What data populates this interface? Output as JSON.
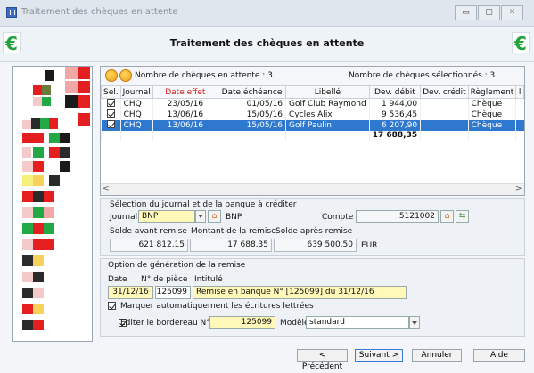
{
  "window": {
    "title": "Traitement des chèques en attente",
    "min": "▭",
    "max": "▢",
    "close": "✕"
  },
  "header": {
    "title": "Traitement des chèques en attente",
    "currency_symbol": "€"
  },
  "grid": {
    "count_pending": "Nombre de chèques en attente : 3",
    "count_selected": "Nombre de chèques sélectionnés : 3",
    "columns": [
      "Sel.",
      "Journal",
      "Date effet",
      "Date échéance",
      "Libellé",
      "Dev. débit",
      "Dev. crédit",
      "Règlement",
      "l"
    ],
    "rows": [
      {
        "journal": "CHQ",
        "date_effet": "23/05/16",
        "date_echeance": "01/05/16",
        "libelle": "Golf Club Raymond",
        "debit": "1 944,00",
        "credit": "",
        "reglement": "Chèque",
        "selected": true,
        "highlighted": false
      },
      {
        "journal": "CHQ",
        "date_effet": "13/06/16",
        "date_echeance": "15/05/16",
        "libelle": "Cycles Alix",
        "debit": "9 536,45",
        "credit": "",
        "reglement": "Chèque",
        "selected": true,
        "highlighted": false
      },
      {
        "journal": "CHQ",
        "date_effet": "13/06/16",
        "date_echeance": "15/05/16",
        "libelle": "Golf Paulin",
        "debit": "6 207,90",
        "credit": "",
        "reglement": "Chèque",
        "selected": true,
        "highlighted": true
      }
    ],
    "total_debit": "17 688,35",
    "scroll_left": "<",
    "scroll_right": ">"
  },
  "journal_section": {
    "heading": "Sélection du journal et de la banque à créditer",
    "journal_label": "Journal",
    "journal_value": "BNP",
    "bank_code": "BNP",
    "compte_label": "Compte",
    "compte_value": "5121002",
    "house_glyph": "⌂",
    "arrows_glyph": "⇆",
    "solde_avant_label": "Solde avant remise",
    "montant_label": "Montant de la remise",
    "solde_apres_label": "Solde après remise",
    "solde_avant": "621 812,15",
    "montant": "17 688,35",
    "solde_apres": "639 500,50",
    "currency": "EUR"
  },
  "option_section": {
    "heading": "Option de génération de la remise",
    "date_label": "Date",
    "piece_label": "N° de pièce",
    "intitule_label": "Intitulé",
    "date_value": "31/12/16",
    "piece_value": "125099",
    "intitule_value": "Remise en banque N° [125099] du 31/12/16",
    "marquer_label": "Marquer automatiquement les écritures lettrées",
    "editer_label": "Editer le bordereau N° :",
    "bordereau_value": "125099",
    "modele_label": "Modèle",
    "modele_value": "standard"
  },
  "footer": {
    "precedent": "< Précédent",
    "suivant": "Suivant >",
    "annuler": "Annuler",
    "aide": "Aide"
  },
  "colors": {
    "accent": "#2f78cf",
    "highlight_field": "#fff8b8",
    "red_header": "#d41f1f",
    "euro_green": "#23a33a"
  }
}
